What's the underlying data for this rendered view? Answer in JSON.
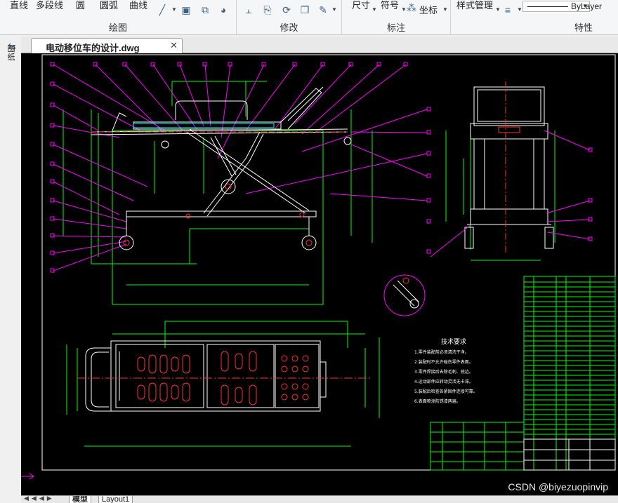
{
  "ribbon": {
    "draw": {
      "line": "直线",
      "polyline": "多段线",
      "circle": "圆",
      "arc": "圆弧",
      "curve": "曲线",
      "title": "绘图"
    },
    "modify": {
      "title": "修改"
    },
    "annotate": {
      "dimension": "尺寸",
      "symbol": "符号",
      "coord": "坐标",
      "title": "标注"
    },
    "properties": {
      "style_manager": "样式管理",
      "layer_value": "ByLayer",
      "title": "特性"
    }
  },
  "left_panel": {
    "label": "图纸"
  },
  "document": {
    "tab_name": "电动移位车的设计.dwg",
    "close": "✕"
  },
  "layout_tabs": {
    "model": "模型",
    "layout1": "Layout1"
  },
  "drawing": {
    "tech_title": "技术要求",
    "tech_lines": [
      "1.零件装配前必须清洗干净。",
      "2.装配时不允许碰伤零件表面。",
      "3.零件焊接后去除毛刺、锐边。",
      "4.运动部件应转动灵活无卡滞。",
      "5.装配后检查各紧固件连接可靠。",
      "6.表面喷涂防锈漆两遍。"
    ]
  },
  "watermark": "CSDN @biyezuopinvip",
  "colors": {
    "canvas": "#000000",
    "green": "#00ff00",
    "white": "#ffffff",
    "magenta": "#ff00ff",
    "red": "#ff3030",
    "yellow": "#ffff00",
    "cyan": "#00ffff"
  }
}
